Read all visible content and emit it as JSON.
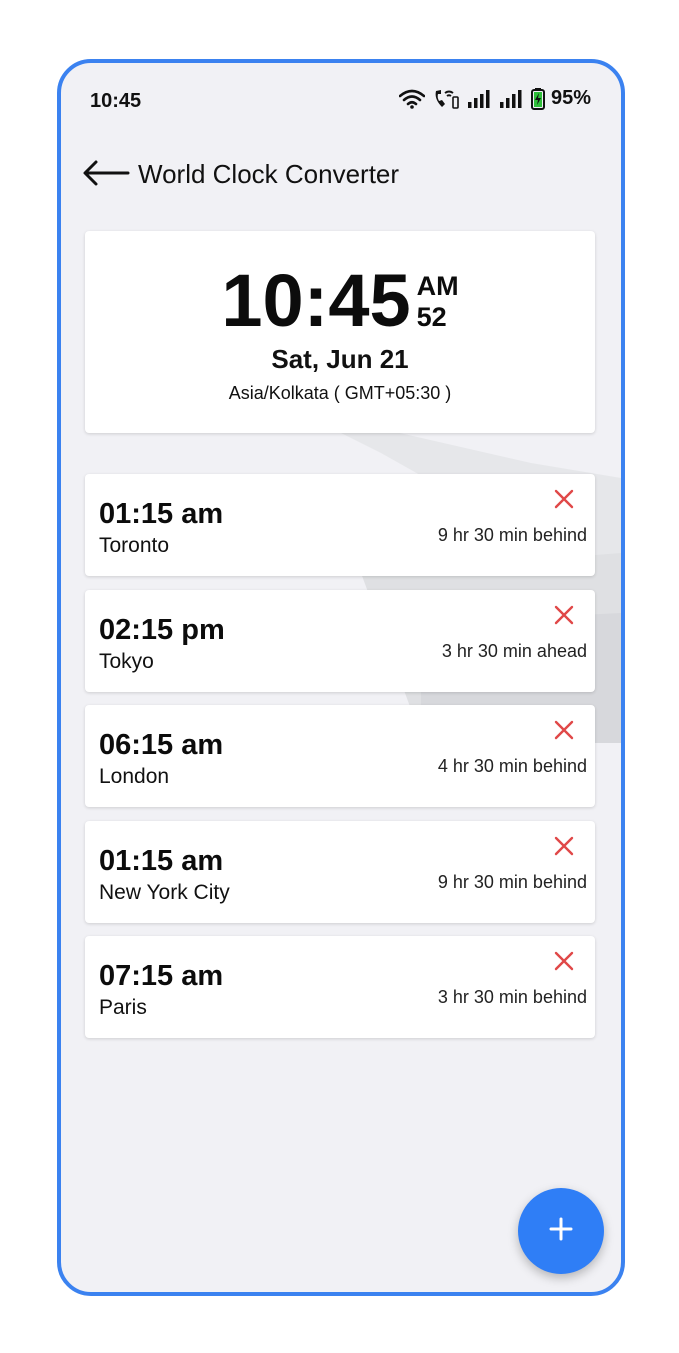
{
  "status_bar": {
    "time": "10:45",
    "battery_percent": "95%",
    "icons": [
      "wifi-icon",
      "wifi-calling-icon",
      "signal-sim1-icon",
      "signal-sim2-icon",
      "battery-charging-icon"
    ]
  },
  "app_bar": {
    "title": "World Clock Converter",
    "back_icon": "arrow-left-icon"
  },
  "current_clock": {
    "time": "10:45",
    "period": "AM",
    "seconds": "52",
    "date": "Sat, Jun 21",
    "timezone": "Asia/Kolkata ( GMT+05:30 )"
  },
  "cities": [
    {
      "time": "01:15 am",
      "name": "Toronto",
      "difference": "9 hr 30 min behind"
    },
    {
      "time": "02:15 pm",
      "name": "Tokyo",
      "difference": "3 hr 30 min ahead"
    },
    {
      "time": "06:15 am",
      "name": "London",
      "difference": "4 hr 30 min behind"
    },
    {
      "time": "01:15 am",
      "name": "New York City",
      "difference": "9 hr 30 min behind"
    },
    {
      "time": "07:15 am",
      "name": "Paris",
      "difference": "3 hr 30 min behind"
    }
  ],
  "fab": {
    "icon": "plus-icon"
  },
  "colors": {
    "accent": "#2f7ef6",
    "frame": "#3b82f0",
    "remove": "#e04848",
    "background": "#f1f1f5"
  }
}
